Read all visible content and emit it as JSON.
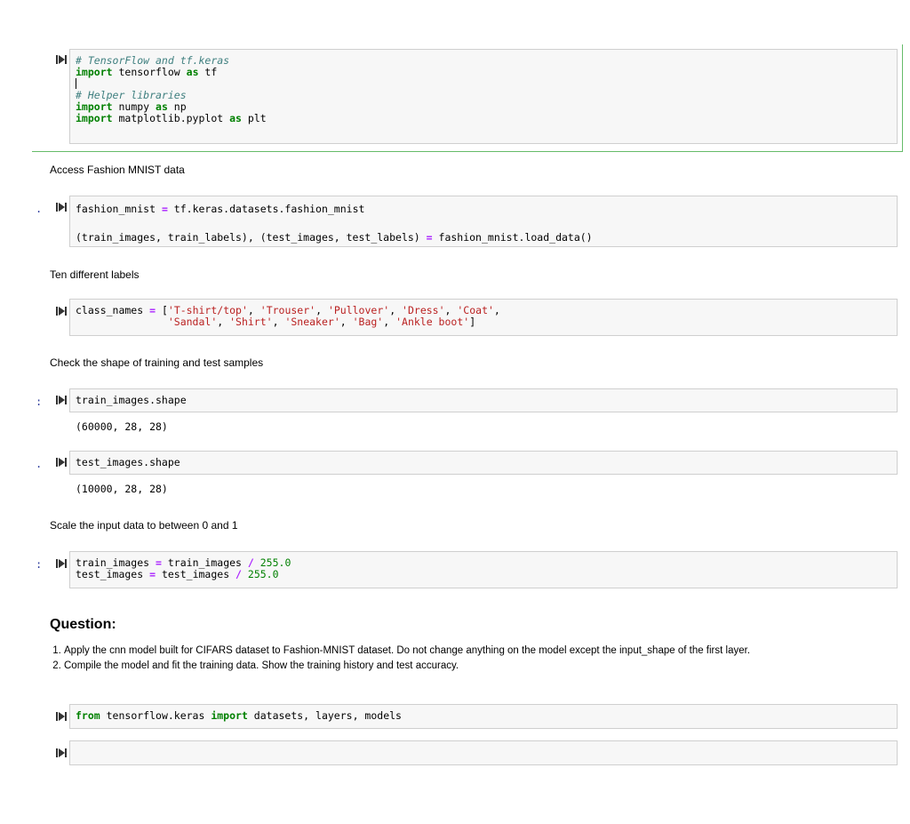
{
  "cells": [
    {
      "prompt": ""
    },
    {
      "prompt": "."
    },
    {
      "prompt": ""
    },
    {
      "prompt": ":"
    },
    {
      "prompt": "."
    },
    {
      "prompt": ":"
    },
    {
      "prompt": ""
    },
    {
      "prompt": ""
    }
  ],
  "code": {
    "c1_l1": "# TensorFlow and tf.keras",
    "c1_l2_kw1": "import",
    "c1_l2_mid": " tensorflow ",
    "c1_l2_kw2": "as",
    "c1_l2_end": " tf",
    "c1_l4": "# Helper libraries",
    "c1_l5_kw1": "import",
    "c1_l5_mid": " numpy ",
    "c1_l5_kw2": "as",
    "c1_l5_end": " np",
    "c1_l6_kw1": "import",
    "c1_l6_mid": " matplotlib.pyplot ",
    "c1_l6_kw2": "as",
    "c1_l6_end": " plt",
    "c2_l1_a": "fashion_mnist ",
    "c2_l1_eq": "=",
    "c2_l1_b": " tf.keras.datasets.fashion_mnist",
    "c2_l3_a": "(train_images, train_labels), (test_images, test_labels) ",
    "c2_l3_eq": "=",
    "c2_l3_b": " fashion_mnist.load_data()",
    "c3_l1_a": "class_names ",
    "c3_l1_eq": "=",
    "c3_l1_b": " [",
    "c3_s1": "'T-shirt/top'",
    "c3_s2": "'Trouser'",
    "c3_s3": "'Pullover'",
    "c3_s4": "'Dress'",
    "c3_s5": "'Coat'",
    "c3_s6": "'Sandal'",
    "c3_s7": "'Shirt'",
    "c3_s8": "'Sneaker'",
    "c3_s9": "'Bag'",
    "c3_s10": "'Ankle boot'",
    "c4_l1": "train_images.shape",
    "c4_out": "(60000, 28, 28)",
    "c5_l1": "test_images.shape",
    "c5_out": "(10000, 28, 28)",
    "c6_l1_a": "train_images ",
    "c6_l1_b": " train_images ",
    "c6_l2_a": "test_images ",
    "c6_l2_b": " test_images ",
    "c6_eq": "=",
    "c6_div": "/",
    "c6_num": " 255.0",
    "c7_kw1": "from",
    "c7_mid": " tensorflow.keras ",
    "c7_kw2": "import",
    "c7_end": " datasets, layers, models"
  },
  "markdown": {
    "m1": "Access Fashion MNIST data",
    "m2": "Ten different labels",
    "m3": "Check the shape of training and test samples",
    "m4": "Scale the input data to between 0 and 1",
    "question_title": "Question:",
    "q1": "Apply the cnn model built for CIFARS dataset to Fashion-MNIST dataset. Do not change anything on the model except the input_shape of the first layer.",
    "q2": "Compile the model and fit the training data. Show the training history and test accuracy."
  },
  "icons": {
    "run": "run-cell-icon"
  },
  "colors": {
    "selected": "#66bb6a",
    "prompt": "#303f9f",
    "cell_bg": "#f7f7f7"
  }
}
